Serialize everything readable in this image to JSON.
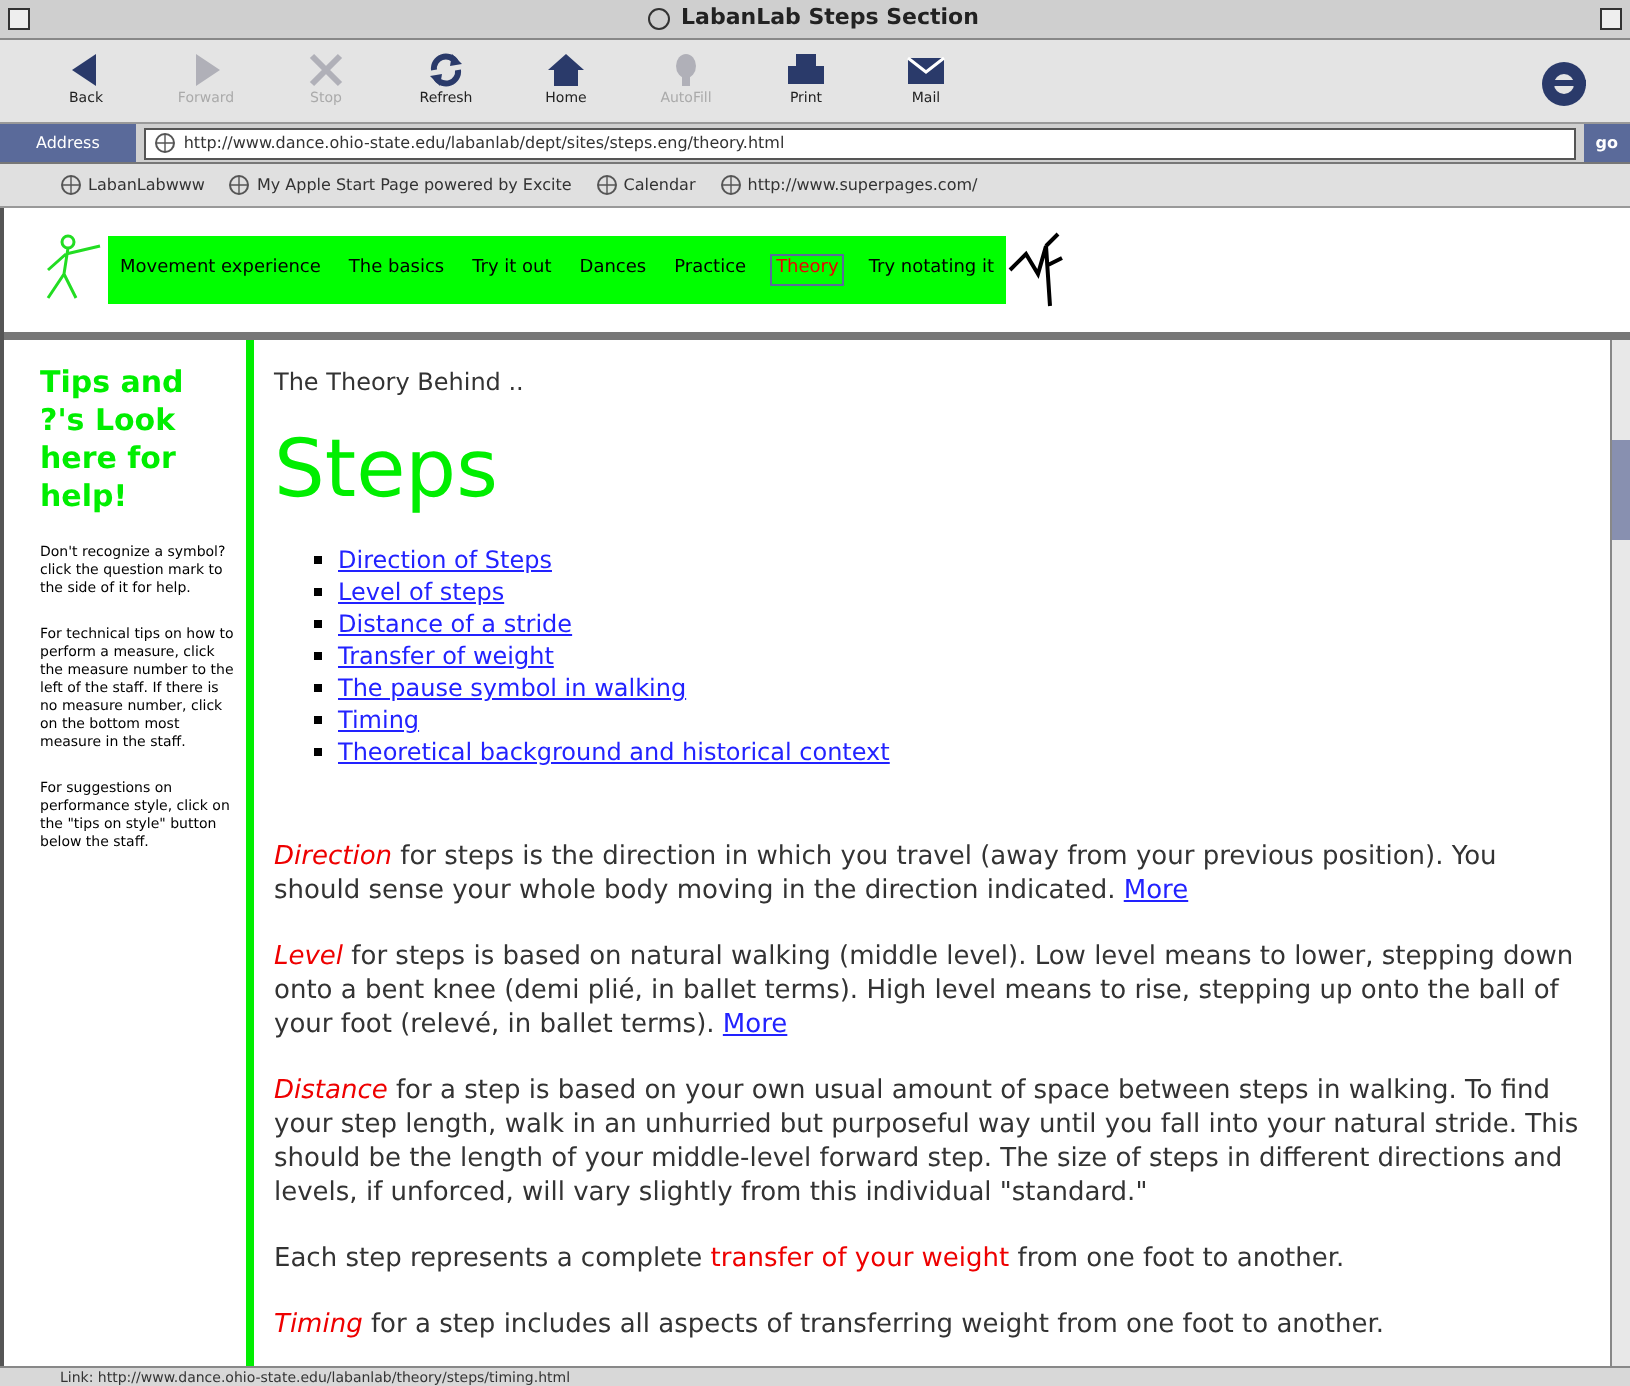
{
  "window": {
    "title": "LabanLab Steps Section"
  },
  "toolbar": [
    {
      "label": "Back",
      "kind": "back",
      "disabled": false
    },
    {
      "label": "Forward",
      "kind": "forward",
      "disabled": true
    },
    {
      "label": "Stop",
      "kind": "stop",
      "disabled": true
    },
    {
      "label": "Refresh",
      "kind": "refresh",
      "disabled": false
    },
    {
      "label": "Home",
      "kind": "home",
      "disabled": false
    },
    {
      "label": "AutoFill",
      "kind": "autofill",
      "disabled": true
    },
    {
      "label": "Print",
      "kind": "print",
      "disabled": false
    },
    {
      "label": "Mail",
      "kind": "mail",
      "disabled": false
    }
  ],
  "address_bar": {
    "label": "Address",
    "value": "http://www.dance.ohio-state.edu/labanlab/dept/sites/steps.eng/theory.html",
    "go": "go"
  },
  "favorites": [
    "LabanLabwww",
    "My Apple Start Page powered by Excite",
    "Calendar",
    "http://www.superpages.com/"
  ],
  "nav": [
    {
      "label": "Movement experience",
      "selected": false
    },
    {
      "label": "The basics",
      "selected": false
    },
    {
      "label": "Try it out",
      "selected": false
    },
    {
      "label": "Dances",
      "selected": false
    },
    {
      "label": "Practice",
      "selected": false
    },
    {
      "label": "Theory",
      "selected": true
    },
    {
      "label": "Try notating it",
      "selected": false
    }
  ],
  "sidebar": {
    "heading": "Tips and ?'s Look here for help!",
    "paragraphs": [
      "Don't recognize a symbol? click the question mark to the side of it for help.",
      "For technical tips on how to perform a measure, click the measure number to the left of the staff. If there is no measure number, click on the bottom most measure in the staff.",
      "For suggestions on performance style, click on the \"tips on style\" button below the staff."
    ]
  },
  "main": {
    "kicker": "The Theory Behind ..",
    "title": "Steps",
    "links": [
      "Direction of Steps",
      "Level of steps",
      "Distance of a stride",
      "Transfer of weight",
      "The pause symbol in walking",
      "Timing",
      "Theoretical background and historical context"
    ],
    "paragraphs": [
      {
        "lead": "Direction",
        "kind": "term",
        "text": " for steps is the direction in which you travel (away from your previous position). You should sense your whole body moving in the direction indicated. ",
        "more": "More"
      },
      {
        "lead": "Level",
        "kind": "term",
        "text": " for steps is based on natural walking (middle level). Low level means to lower, stepping down onto a bent knee (demi plié, in ballet terms). High level means to rise, stepping up onto the ball of your foot (relevé, in ballet terms). ",
        "more": "More"
      },
      {
        "lead": "Distance",
        "kind": "term",
        "text": " for a step is based on your own usual amount of space between steps in walking. To find your step length, walk in an unhurried but purposeful way until you fall into your natural stride. This should be the length of your middle-level forward step. The size of steps in different directions and levels, if unforced, will vary slightly from this individual \"standard.\""
      },
      {
        "before": "Each step represents a complete ",
        "lead": "transfer of your weight",
        "kind": "highlight",
        "text": " from one foot to another."
      },
      {
        "lead": "Timing",
        "kind": "term",
        "text": " for a step includes all aspects of transferring weight from one foot to another."
      }
    ]
  },
  "status_bar": "Link: http://www.dance.ohio-state.edu/labanlab/theory/steps/timing.html"
}
